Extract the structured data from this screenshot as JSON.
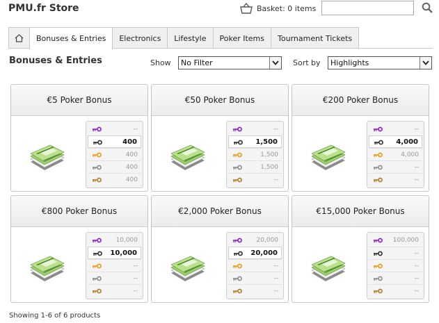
{
  "header": {
    "store_title": "PMU.fr Store",
    "basket_label": "Basket: 0 items",
    "search_value": ""
  },
  "tabs": [
    {
      "label": "",
      "icon": "home-icon"
    },
    {
      "label": "Bonuses & Entries",
      "active": true
    },
    {
      "label": "Electronics"
    },
    {
      "label": "Lifestyle"
    },
    {
      "label": "Poker Items"
    },
    {
      "label": "Tournament Tickets"
    }
  ],
  "toolbar": {
    "section_title": "Bonuses & Entries",
    "show_label": "Show",
    "filter_value": "No Filter",
    "sortby_label": "Sort by",
    "sort_value": "Highlights"
  },
  "key_colors": [
    "#8a1bd6",
    "#2b2b2b",
    "#e49a12",
    "#8a8a8a",
    "#b07a28"
  ],
  "products": [
    {
      "name": "€5 Poker Bonus",
      "prices": [
        "--",
        "400",
        "400",
        "400",
        "400"
      ],
      "highlight": 1
    },
    {
      "name": "€50 Poker Bonus",
      "prices": [
        "--",
        "1,500",
        "1,500",
        "1,500",
        "--"
      ],
      "highlight": 1
    },
    {
      "name": "€200 Poker Bonus",
      "prices": [
        "--",
        "4,000",
        "4,000",
        "--",
        "--"
      ],
      "highlight": 1
    },
    {
      "name": "€800 Poker Bonus",
      "prices": [
        "10,000",
        "10,000",
        "--",
        "--",
        "--"
      ],
      "highlight": 1
    },
    {
      "name": "€2,000 Poker Bonus",
      "prices": [
        "20,000",
        "20,000",
        "--",
        "--",
        "--"
      ],
      "highlight": 1
    },
    {
      "name": "€15,000 Poker Bonus",
      "prices": [
        "100,000",
        "--",
        "--",
        "--",
        "--"
      ],
      "highlight": -1
    }
  ],
  "footer": {
    "showing": "Showing 1-6 of 6 products"
  }
}
